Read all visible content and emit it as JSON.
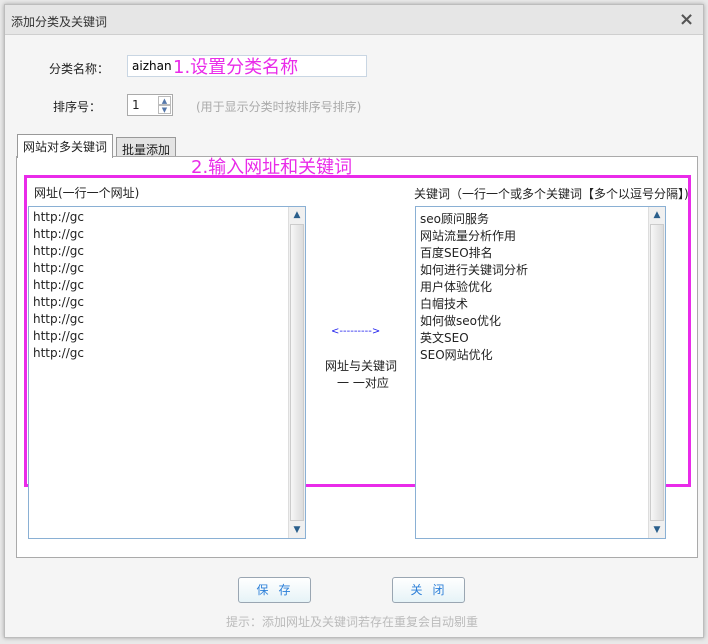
{
  "dialog": {
    "title": "添加分类及关键词",
    "close_icon": "×"
  },
  "form": {
    "category_label": "分类名称：",
    "category_value": "aizhan",
    "annotation1": "1.设置分类名称",
    "order_label": "排序号：",
    "order_value": "1",
    "order_hint": "(用于显示分类时按排序号排序)"
  },
  "tabs": [
    {
      "label": "网站对多关键词"
    },
    {
      "label": "批量添加"
    }
  ],
  "annotation2": "2.输入网址和关键词",
  "urls": {
    "label": "网址(一行一个网址)",
    "lines": [
      "http://gc",
      "http://gc",
      "http://gc",
      "http://gc",
      "http://gc",
      "http://gc",
      "http://gc",
      "http://gc",
      "http://gc"
    ]
  },
  "mapping": {
    "arrow": "<--------->",
    "line1": "网址与关键词",
    "line2": "一 一对应"
  },
  "keywords": {
    "label": "关键词（一行一个或多个关键词【多个以逗号分隔】)",
    "lines": [
      "seo顾问服务",
      "网站流量分析作用",
      "百度SEO排名",
      "如何进行关键词分析",
      "用户体验优化",
      "白帽技术",
      "如何做seo优化",
      "英文SEO",
      "SEO网站优化"
    ]
  },
  "buttons": {
    "save": "保存",
    "close": "关闭"
  },
  "hint": "提示：添加网址及关键词若存在重复会自动剔重"
}
